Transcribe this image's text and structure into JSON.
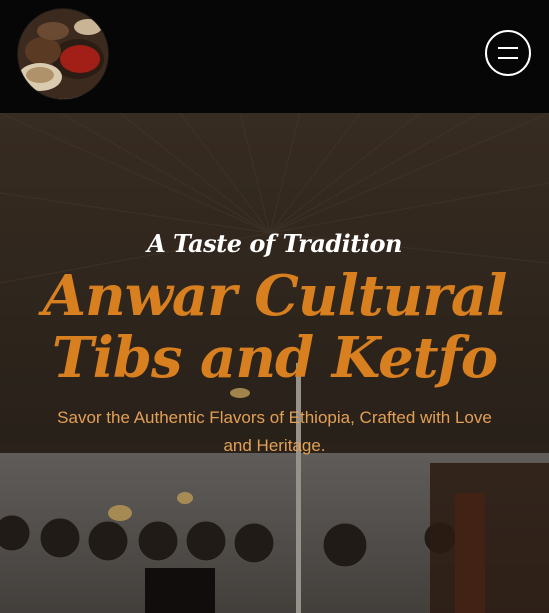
{
  "header": {
    "logo_icon": "dish-photo-logo",
    "menu_icon": "hamburger-menu-icon"
  },
  "hero": {
    "tagline": "A Taste of Tradition",
    "title_line1": "Anwar Cultural",
    "title_line2": "Tibs and Ketfo",
    "subtitle": "Savor the Authentic Flavors of Ethiopia, Crafted with Love and Heritage."
  },
  "colors": {
    "header_bg": "#060606",
    "accent_orange": "#d87f1f",
    "subtitle_orange": "#e2a056",
    "white": "#ffffff"
  }
}
